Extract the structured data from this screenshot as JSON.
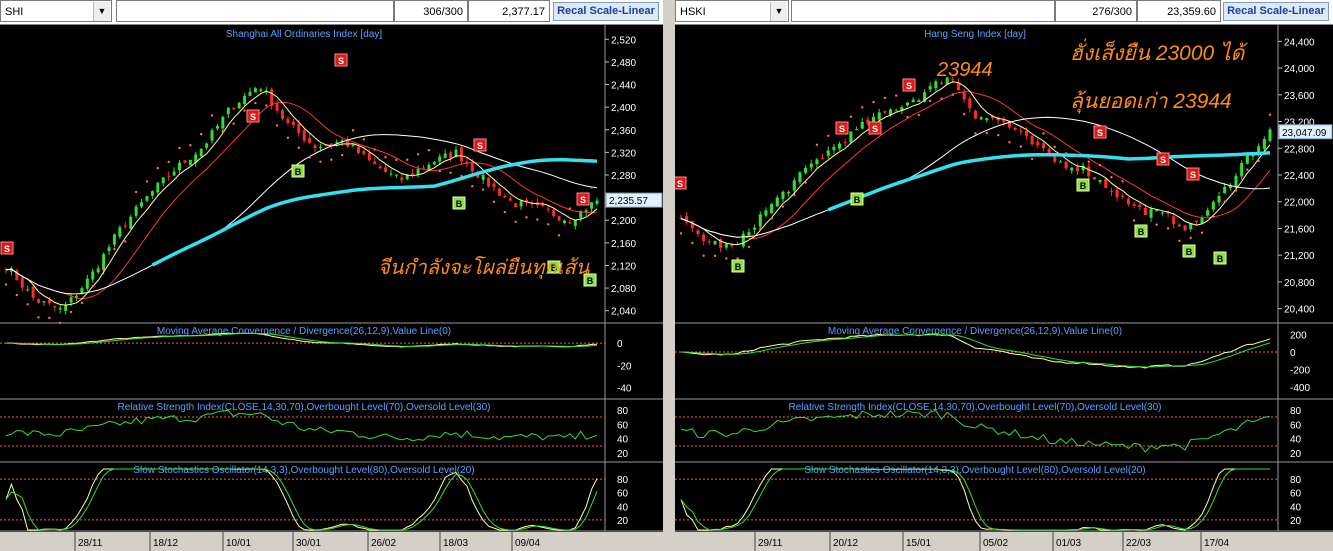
{
  "left": {
    "symbol": "SHI",
    "count": "306/300",
    "last": "2,377.17",
    "button": "Recal Scale-Linear",
    "title": "Shanghai All Ordinaries Index [day]",
    "price_axis": [
      "2,520",
      "2,480",
      "2,440",
      "2,400",
      "2,360",
      "2,320",
      "2,280",
      "2,240",
      "2,200",
      "2,160",
      "2,120",
      "2,080",
      "2,040"
    ],
    "current_price": "2,235.57",
    "annotation": "จีนกำลังจะโผล่ยืนทุกเส้น",
    "macd_title": "Moving Average Convergence / Divergence(26,12,9),Value Line(0)",
    "macd_axis": [
      "0",
      "-20",
      "-40"
    ],
    "rsi_title": "Relative Strength Index(CLOSE,14,30,70),Overbought Level(70),Oversold Level(30)",
    "rsi_axis": [
      "80",
      "60",
      "40",
      "20"
    ],
    "stoch_title": "Slow Stochastics Oscillator(14,3,3),Overbought Level(80),Oversold Level(20)",
    "stoch_axis": [
      "80",
      "60",
      "40",
      "20"
    ],
    "dates": [
      "28/11",
      "18/12",
      "10/01",
      "30/01",
      "26/02",
      "18/03",
      "09/04"
    ]
  },
  "right": {
    "symbol": "HSKI",
    "count": "276/300",
    "last": "23,359.60",
    "button": "Recal Scale-Linear",
    "title": "Hang Seng Index [day]",
    "price_axis": [
      "24,400",
      "24,000",
      "23,600",
      "23,200",
      "22,800",
      "22,400",
      "22,000",
      "21,600",
      "21,200",
      "20,800",
      "20,400"
    ],
    "current_price": "23,047.09",
    "annotation_peak": "23944",
    "annotation_line1": "ฮั่งเส็งยืน 23000 ได้",
    "annotation_line2": "ลุ้นยอดเก่า 23944",
    "macd_title": "Moving Average Convergence / Divergence(26,12,9),Value Line(0)",
    "macd_axis": [
      "200",
      "0",
      "-200",
      "-400"
    ],
    "rsi_title": "Relative Strength Index(CLOSE,14,30,70),Overbought Level(70),Oversold Level(30)",
    "rsi_axis": [
      "80",
      "60",
      "40",
      "20"
    ],
    "stoch_title": "Slow Stochastics Oscillator(14,3,3),Overbought Level(80),Oversold Level(20)",
    "stoch_axis": [
      "80",
      "60",
      "40",
      "20"
    ],
    "dates": [
      "29/11",
      "20/12",
      "15/01",
      "05/02",
      "01/03",
      "22/03",
      "17/04"
    ]
  },
  "chart_data": [
    {
      "type": "candlestick",
      "title": "Shanghai All Ordinaries Index [day]",
      "ylim": [
        2020,
        2540
      ],
      "approx_close_trend": [
        2120,
        2060,
        2040,
        2100,
        2180,
        2240,
        2290,
        2330,
        2400,
        2440,
        2370,
        2330,
        2340,
        2300,
        2270,
        2300,
        2320,
        2270,
        2230,
        2220,
        2200,
        2235
      ],
      "signals": [
        "S",
        "S",
        "B",
        "S",
        "B",
        "S",
        "S",
        "B",
        "B"
      ],
      "ma_colors": [
        "#ff3333",
        "#ffff99",
        "#ffffff",
        "#33e0f0"
      ]
    },
    {
      "type": "candlestick",
      "title": "Hang Seng Index [day]",
      "ylim": [
        20200,
        24600
      ],
      "approx_close_trend": [
        21700,
        21400,
        21300,
        21800,
        22200,
        22600,
        22900,
        23200,
        23400,
        23600,
        23900,
        23300,
        23200,
        22900,
        22600,
        22500,
        22200,
        21900,
        21800,
        21600,
        22000,
        22600,
        23047
      ],
      "signals": [
        "S",
        "B",
        "S",
        "B",
        "S",
        "S",
        "B",
        "S",
        "S",
        "B",
        "S",
        "B",
        "B",
        "B"
      ],
      "ma_colors": [
        "#ff3333",
        "#ffff99",
        "#ffffff",
        "#33e0f0"
      ]
    }
  ]
}
